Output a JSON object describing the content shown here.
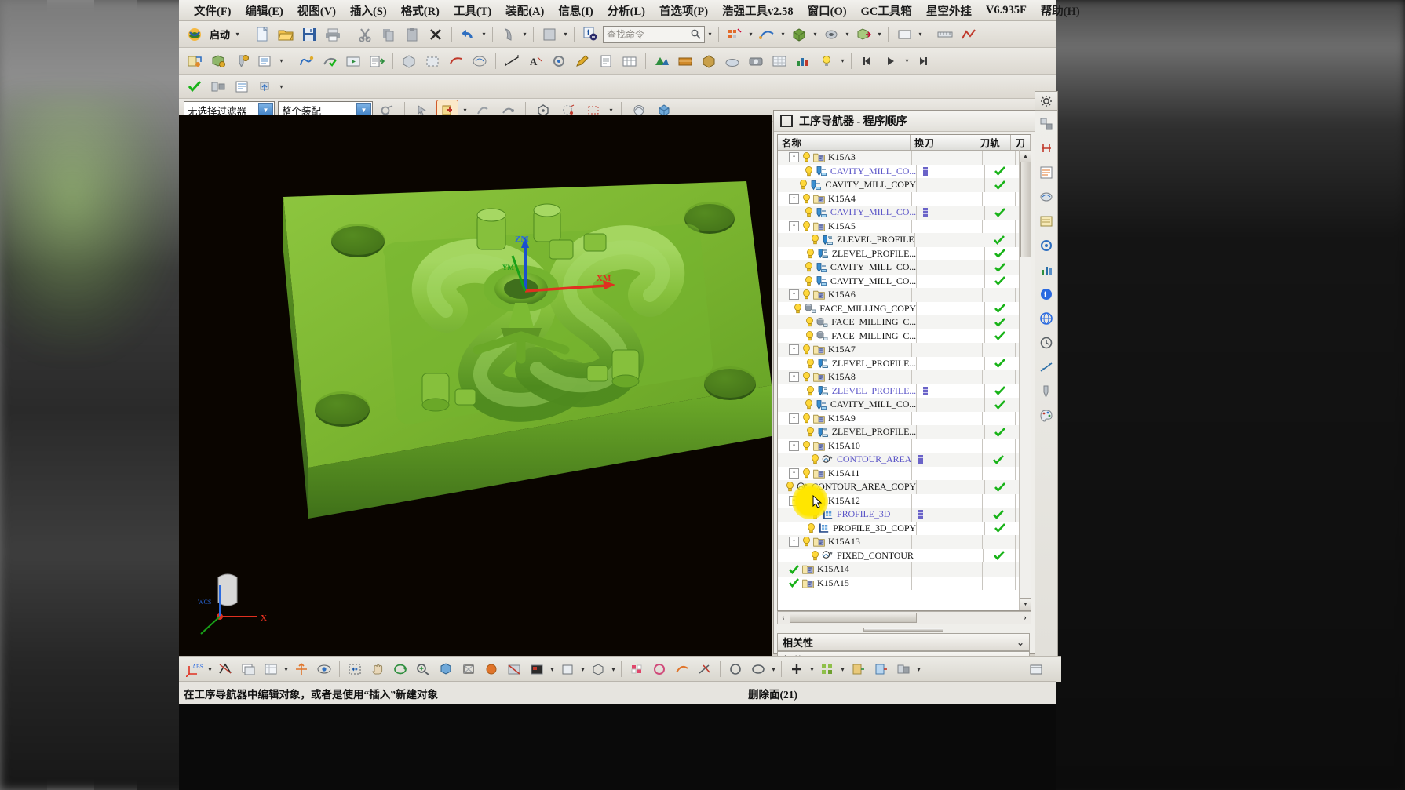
{
  "menubar": {
    "items": [
      {
        "label": "文件(F)"
      },
      {
        "label": "编辑(E)"
      },
      {
        "label": "视图(V)"
      },
      {
        "label": "插入(S)"
      },
      {
        "label": "格式(R)"
      },
      {
        "label": "工具(T)"
      },
      {
        "label": "装配(A)"
      },
      {
        "label": "信息(I)"
      },
      {
        "label": "分析(L)"
      },
      {
        "label": "首选项(P)"
      },
      {
        "label": "浩强工具v2.58"
      },
      {
        "label": "窗口(O)"
      },
      {
        "label": "GC工具箱"
      },
      {
        "label": "星空外挂"
      },
      {
        "label": "V6.935F"
      },
      {
        "label": "帮助(H)"
      }
    ]
  },
  "toolbar": {
    "start_label": "启动",
    "find_placeholder": "查找命令"
  },
  "selectionbar": {
    "filter_value": "无选择过滤器",
    "scope_value": "整个装配"
  },
  "navigator": {
    "title": "工序导航器 - 程序顺序",
    "columns": [
      {
        "label": "名称"
      },
      {
        "label": "换刀"
      },
      {
        "label": "刀轨"
      },
      {
        "label": "刀"
      }
    ],
    "rows": [
      {
        "name": "K15A3",
        "level": 0,
        "kind": "group",
        "expander": "-",
        "icon": "program-folder-icon",
        "state": "bulb",
        "change": "",
        "path": ""
      },
      {
        "name": "CAVITY_MILL_CO...",
        "level": 1,
        "kind": "op",
        "icon": "cavity-mill-icon",
        "state": "bulb",
        "change": "bar",
        "path": "check",
        "blue": true
      },
      {
        "name": "CAVITY_MILL_COPY",
        "level": 1,
        "kind": "op",
        "icon": "cavity-mill-icon",
        "state": "bulb",
        "change": "",
        "path": "check",
        "blue": false
      },
      {
        "name": "K15A4",
        "level": 0,
        "kind": "group",
        "expander": "-",
        "icon": "program-folder-icon",
        "state": "bulb",
        "change": "",
        "path": ""
      },
      {
        "name": "CAVITY_MILL_CO...",
        "level": 1,
        "kind": "op",
        "icon": "cavity-mill-icon",
        "state": "bulb",
        "change": "bar",
        "path": "check",
        "blue": true
      },
      {
        "name": "K15A5",
        "level": 0,
        "kind": "group",
        "expander": "-",
        "icon": "program-folder-icon",
        "state": "bulb",
        "change": "",
        "path": ""
      },
      {
        "name": "ZLEVEL_PROFILE",
        "level": 1,
        "kind": "op",
        "icon": "zlevel-profile-icon",
        "state": "bulb",
        "change": "",
        "path": "check",
        "blue": false
      },
      {
        "name": "ZLEVEL_PROFILE...",
        "level": 1,
        "kind": "op",
        "icon": "zlevel-profile-icon",
        "state": "bulb",
        "change": "",
        "path": "check",
        "blue": false
      },
      {
        "name": "CAVITY_MILL_CO...",
        "level": 1,
        "kind": "op",
        "icon": "cavity-mill-icon",
        "state": "bulb",
        "change": "",
        "path": "check",
        "blue": false
      },
      {
        "name": "CAVITY_MILL_CO...",
        "level": 1,
        "kind": "op",
        "icon": "cavity-mill-icon",
        "state": "bulb",
        "change": "",
        "path": "check",
        "blue": false
      },
      {
        "name": "K15A6",
        "level": 0,
        "kind": "group",
        "expander": "-",
        "icon": "program-folder-icon",
        "state": "bulb",
        "change": "",
        "path": ""
      },
      {
        "name": "FACE_MILLING_COPY",
        "level": 1,
        "kind": "op",
        "icon": "face-milling-icon",
        "state": "bulb",
        "change": "",
        "path": "check",
        "blue": false
      },
      {
        "name": "FACE_MILLING_C...",
        "level": 1,
        "kind": "op",
        "icon": "face-milling-icon",
        "state": "bulb",
        "change": "",
        "path": "check",
        "blue": false
      },
      {
        "name": "FACE_MILLING_C...",
        "level": 1,
        "kind": "op",
        "icon": "face-milling-icon",
        "state": "bulb",
        "change": "",
        "path": "check",
        "blue": false
      },
      {
        "name": "K15A7",
        "level": 0,
        "kind": "group",
        "expander": "-",
        "icon": "program-folder-icon",
        "state": "bulb",
        "change": "",
        "path": ""
      },
      {
        "name": "ZLEVEL_PROFILE...",
        "level": 1,
        "kind": "op",
        "icon": "zlevel-profile-icon",
        "state": "bulb",
        "change": "",
        "path": "check",
        "blue": false
      },
      {
        "name": "K15A8",
        "level": 0,
        "kind": "group",
        "expander": "-",
        "icon": "program-folder-icon",
        "state": "bulb",
        "change": "",
        "path": ""
      },
      {
        "name": "ZLEVEL_PROFILE...",
        "level": 1,
        "kind": "op",
        "icon": "zlevel-profile-icon",
        "state": "bulb",
        "change": "bar",
        "path": "check",
        "blue": true
      },
      {
        "name": "CAVITY_MILL_CO...",
        "level": 1,
        "kind": "op",
        "icon": "cavity-mill-icon",
        "state": "bulb",
        "change": "",
        "path": "check",
        "blue": false
      },
      {
        "name": "K15A9",
        "level": 0,
        "kind": "group",
        "expander": "-",
        "icon": "program-folder-icon",
        "state": "bulb",
        "change": "",
        "path": ""
      },
      {
        "name": "ZLEVEL_PROFILE...",
        "level": 1,
        "kind": "op",
        "icon": "zlevel-profile-icon",
        "state": "bulb",
        "change": "",
        "path": "check",
        "blue": false
      },
      {
        "name": "K15A10",
        "level": 0,
        "kind": "group",
        "expander": "-",
        "icon": "program-folder-icon",
        "state": "bulb",
        "change": "",
        "path": ""
      },
      {
        "name": "CONTOUR_AREA",
        "level": 1,
        "kind": "op",
        "icon": "contour-area-icon",
        "state": "bulb",
        "change": "bar",
        "path": "check",
        "blue": true
      },
      {
        "name": "K15A11",
        "level": 0,
        "kind": "group",
        "expander": "-",
        "icon": "program-folder-icon",
        "state": "bulb",
        "change": "",
        "path": ""
      },
      {
        "name": "CONTOUR_AREA_COPY",
        "level": 1,
        "kind": "op",
        "icon": "contour-area-icon",
        "state": "bulb",
        "change": "",
        "path": "check",
        "blue": false
      },
      {
        "name": "K15A12",
        "level": 0,
        "kind": "group",
        "expander": "-",
        "icon": "program-folder-icon",
        "state": "bulb",
        "change": "",
        "path": ""
      },
      {
        "name": "PROFILE_3D",
        "level": 1,
        "kind": "op",
        "icon": "profile-3d-icon",
        "state": "bulb",
        "change": "bar",
        "path": "check",
        "blue": true
      },
      {
        "name": "PROFILE_3D_COPY",
        "level": 1,
        "kind": "op",
        "icon": "profile-3d-icon",
        "state": "bulb",
        "change": "",
        "path": "check",
        "blue": false
      },
      {
        "name": "K15A13",
        "level": 0,
        "kind": "group",
        "expander": "-",
        "icon": "program-folder-icon",
        "state": "bulb",
        "change": "",
        "path": ""
      },
      {
        "name": "FIXED_CONTOUR",
        "level": 1,
        "kind": "op",
        "icon": "contour-area-icon",
        "state": "bulb",
        "change": "",
        "path": "check",
        "blue": false
      },
      {
        "name": "K15A14",
        "level": 0,
        "kind": "group",
        "expander": "",
        "icon": "program-folder-icon",
        "state": "check",
        "change": "",
        "path": ""
      },
      {
        "name": "K15A15",
        "level": 0,
        "kind": "group",
        "expander": "",
        "icon": "program-folder-icon",
        "state": "check",
        "change": "",
        "path": ""
      }
    ],
    "accordion": [
      {
        "label": "相关性",
        "chevron": "⌄"
      },
      {
        "label": "细节",
        "chevron": "⌄"
      }
    ]
  },
  "viewport": {
    "axis_labels": {
      "z": "ZM",
      "x": "XM",
      "y": "YM"
    },
    "wcs_label": "WCS",
    "triad_x": "X"
  },
  "statusbar": {
    "message": "在工序导航器中编辑对象，或者是使用“插入”新建对象",
    "right": "删除面(21)"
  }
}
